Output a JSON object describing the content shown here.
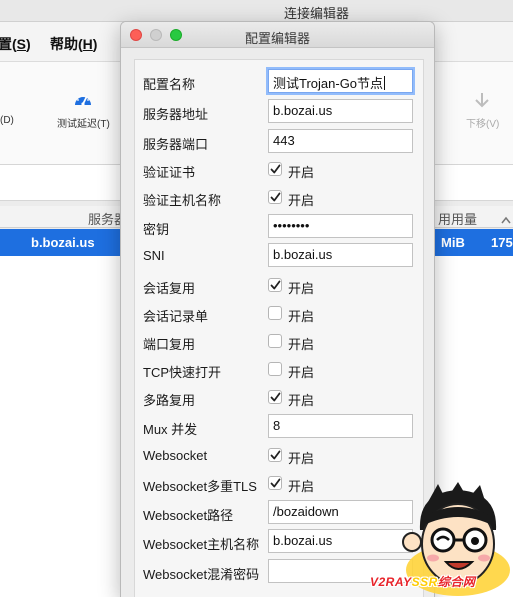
{
  "main_window": {
    "title": "连接编辑器",
    "menu": [
      {
        "text": "置(",
        "key": "S",
        "close": ")"
      },
      {
        "text": "帮助(",
        "key": "H",
        "close": ")"
      }
    ],
    "toolbar": {
      "left_partial_label": "(D)",
      "latency_label": "测试延迟(T)",
      "move_down_label": "下移(V)"
    },
    "table": {
      "header_server": "服务器",
      "header_usage": "用用量",
      "selected_row": {
        "address": "b.bozai.us",
        "unit": "MiB",
        "value": "175"
      }
    }
  },
  "dialog": {
    "title": "配置编辑器",
    "fields": [
      {
        "label": "配置名称",
        "type": "text",
        "value": "测试Trojan-Go节点",
        "focused": true
      },
      {
        "label": "服务器地址",
        "type": "text",
        "value": "b.bozai.us"
      },
      {
        "label": "服务器端口",
        "type": "text",
        "value": "443"
      },
      {
        "label": "验证证书",
        "type": "check",
        "checked": true,
        "text": "开启"
      },
      {
        "label": "验证主机名称",
        "type": "check",
        "checked": true,
        "text": "开启"
      },
      {
        "label": "密钥",
        "type": "text",
        "value": "••••••••"
      },
      {
        "label": "SNI",
        "type": "text",
        "value": "b.bozai.us"
      },
      {
        "label": "会话复用",
        "type": "check",
        "checked": true,
        "text": "开启"
      },
      {
        "label": "会话记录单",
        "type": "check",
        "checked": false,
        "text": "开启"
      },
      {
        "label": "端口复用",
        "type": "check",
        "checked": false,
        "text": "开启"
      },
      {
        "label": "TCP快速打开",
        "type": "check",
        "checked": false,
        "text": "开启"
      },
      {
        "label": "多路复用",
        "type": "check",
        "checked": true,
        "text": "开启"
      },
      {
        "label": "Mux 并发",
        "type": "text",
        "value": "8"
      },
      {
        "label": "Websocket",
        "type": "check",
        "checked": true,
        "text": "开启"
      },
      {
        "label": "Websocket多重TLS",
        "type": "check",
        "checked": true,
        "text": "开启"
      },
      {
        "label": "Websocket路径",
        "type": "text",
        "value": "/bozaidown"
      },
      {
        "label": "Websocket主机名称",
        "type": "text",
        "value": "b.bozai.us"
      },
      {
        "label": "Websocket混淆密码",
        "type": "text",
        "value": ""
      }
    ]
  },
  "watermark": {
    "part1": "V2RAY",
    "part2": "SSR",
    "part3": "综合网"
  },
  "colors": {
    "selection": "#1e6fe0",
    "traffic_close": "#fd5f57",
    "traffic_max": "#28c941",
    "watermark_red": "#e8232a"
  }
}
